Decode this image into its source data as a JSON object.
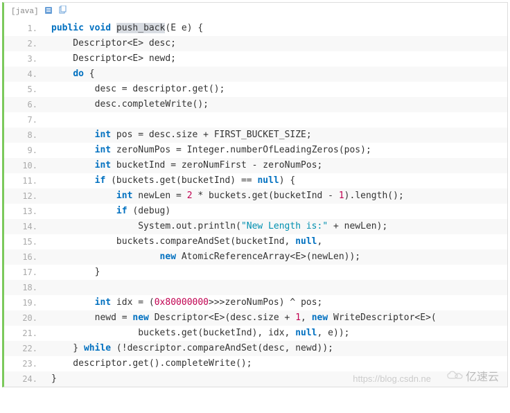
{
  "header": {
    "lang": "[java]"
  },
  "lines": [
    {
      "n": "1.",
      "ind": 0,
      "seg": [
        [
          "kw",
          "public"
        ],
        [
          "sp",
          " "
        ],
        [
          "kw",
          "void"
        ],
        [
          "sp",
          " "
        ],
        [
          "hl",
          "push_back"
        ],
        [
          "pl",
          "(E e) {"
        ]
      ]
    },
    {
      "n": "2.",
      "ind": 1,
      "seg": [
        [
          "pl",
          "Descriptor<E> desc;"
        ]
      ]
    },
    {
      "n": "3.",
      "ind": 1,
      "seg": [
        [
          "pl",
          "Descriptor<E> newd;"
        ]
      ]
    },
    {
      "n": "4.",
      "ind": 1,
      "seg": [
        [
          "kw",
          "do"
        ],
        [
          "sp",
          " "
        ],
        [
          "pl",
          "{"
        ]
      ]
    },
    {
      "n": "5.",
      "ind": 2,
      "seg": [
        [
          "pl",
          "desc = descriptor.get();"
        ]
      ]
    },
    {
      "n": "6.",
      "ind": 2,
      "seg": [
        [
          "pl",
          "desc.completeWrite();"
        ]
      ]
    },
    {
      "n": "7.",
      "ind": 0,
      "seg": [
        [
          "pl",
          ""
        ]
      ]
    },
    {
      "n": "8.",
      "ind": 2,
      "seg": [
        [
          "kw",
          "int"
        ],
        [
          "sp",
          " "
        ],
        [
          "pl",
          "pos = desc.size + FIRST_BUCKET_SIZE;"
        ]
      ]
    },
    {
      "n": "9.",
      "ind": 2,
      "seg": [
        [
          "kw",
          "int"
        ],
        [
          "sp",
          " "
        ],
        [
          "pl",
          "zeroNumPos = Integer.numberOfLeadingZeros(pos);"
        ]
      ]
    },
    {
      "n": "10.",
      "ind": 2,
      "seg": [
        [
          "kw",
          "int"
        ],
        [
          "sp",
          " "
        ],
        [
          "pl",
          "bucketInd = zeroNumFirst - zeroNumPos;"
        ]
      ]
    },
    {
      "n": "11.",
      "ind": 2,
      "seg": [
        [
          "kw",
          "if"
        ],
        [
          "sp",
          " "
        ],
        [
          "pl",
          "(buckets.get(bucketInd) == "
        ],
        [
          "kw",
          "null"
        ],
        [
          "pl",
          ") {"
        ]
      ]
    },
    {
      "n": "12.",
      "ind": 3,
      "seg": [
        [
          "kw",
          "int"
        ],
        [
          "sp",
          " "
        ],
        [
          "pl",
          "newLen = "
        ],
        [
          "num",
          "2"
        ],
        [
          "sp",
          " "
        ],
        [
          "pl",
          "* buckets.get(bucketInd - "
        ],
        [
          "num",
          "1"
        ],
        [
          "pl",
          ").length();"
        ]
      ]
    },
    {
      "n": "13.",
      "ind": 3,
      "seg": [
        [
          "kw",
          "if"
        ],
        [
          "sp",
          " "
        ],
        [
          "pl",
          "(debug)"
        ]
      ]
    },
    {
      "n": "14.",
      "ind": 4,
      "seg": [
        [
          "pl",
          "System.out.println("
        ],
        [
          "str",
          "\"New Length is:\""
        ],
        [
          "sp",
          " "
        ],
        [
          "pl",
          "+ newLen);"
        ]
      ]
    },
    {
      "n": "15.",
      "ind": 3,
      "seg": [
        [
          "pl",
          "buckets.compareAndSet(bucketInd, "
        ],
        [
          "kw",
          "null"
        ],
        [
          "pl",
          ","
        ]
      ]
    },
    {
      "n": "16.",
      "ind": 5,
      "seg": [
        [
          "kw",
          "new"
        ],
        [
          "sp",
          " "
        ],
        [
          "pl",
          "AtomicReferenceArray<E>(newLen));"
        ]
      ]
    },
    {
      "n": "17.",
      "ind": 2,
      "seg": [
        [
          "pl",
          "}"
        ]
      ]
    },
    {
      "n": "18.",
      "ind": 0,
      "seg": [
        [
          "pl",
          ""
        ]
      ]
    },
    {
      "n": "19.",
      "ind": 2,
      "seg": [
        [
          "kw",
          "int"
        ],
        [
          "sp",
          " "
        ],
        [
          "pl",
          "idx = ("
        ],
        [
          "num",
          "0x80000000"
        ],
        [
          "pl",
          ">>>zeroNumPos) ^ pos;"
        ]
      ]
    },
    {
      "n": "20.",
      "ind": 2,
      "seg": [
        [
          "pl",
          "newd = "
        ],
        [
          "kw",
          "new"
        ],
        [
          "sp",
          " "
        ],
        [
          "pl",
          "Descriptor<E>(desc.size + "
        ],
        [
          "num",
          "1"
        ],
        [
          "pl",
          ", "
        ],
        [
          "kw",
          "new"
        ],
        [
          "sp",
          " "
        ],
        [
          "pl",
          "WriteDescriptor<E>("
        ]
      ]
    },
    {
      "n": "21.",
      "ind": 4,
      "seg": [
        [
          "pl",
          "buckets.get(bucketInd), idx, "
        ],
        [
          "kw",
          "null"
        ],
        [
          "pl",
          ", e));"
        ]
      ]
    },
    {
      "n": "22.",
      "ind": 1,
      "seg": [
        [
          "pl",
          "} "
        ],
        [
          "kw",
          "while"
        ],
        [
          "sp",
          " "
        ],
        [
          "pl",
          "(!descriptor.compareAndSet(desc, newd));"
        ]
      ]
    },
    {
      "n": "23.",
      "ind": 1,
      "seg": [
        [
          "pl",
          "descriptor.get().completeWrite();"
        ]
      ]
    },
    {
      "n": "24.",
      "ind": 0,
      "seg": [
        [
          "pl",
          "}"
        ]
      ]
    }
  ],
  "watermark": "https://blog.csdn.ne",
  "logo_text": "亿速云",
  "indent_unit": "    "
}
